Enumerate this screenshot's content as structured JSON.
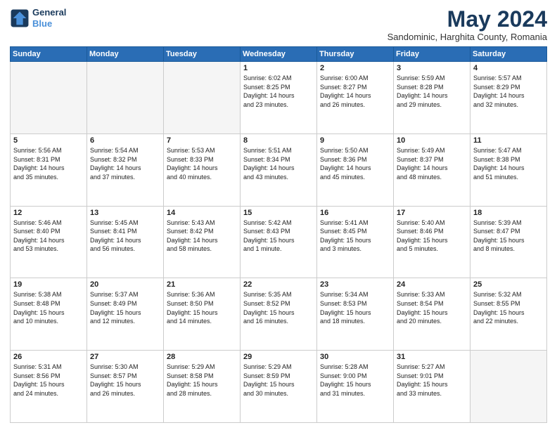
{
  "header": {
    "logo_line1": "General",
    "logo_line2": "Blue",
    "month": "May 2024",
    "location": "Sandominic, Harghita County, Romania"
  },
  "weekdays": [
    "Sunday",
    "Monday",
    "Tuesday",
    "Wednesday",
    "Thursday",
    "Friday",
    "Saturday"
  ],
  "weeks": [
    [
      {
        "day": "",
        "text": ""
      },
      {
        "day": "",
        "text": ""
      },
      {
        "day": "",
        "text": ""
      },
      {
        "day": "1",
        "text": "Sunrise: 6:02 AM\nSunset: 8:25 PM\nDaylight: 14 hours\nand 23 minutes."
      },
      {
        "day": "2",
        "text": "Sunrise: 6:00 AM\nSunset: 8:27 PM\nDaylight: 14 hours\nand 26 minutes."
      },
      {
        "day": "3",
        "text": "Sunrise: 5:59 AM\nSunset: 8:28 PM\nDaylight: 14 hours\nand 29 minutes."
      },
      {
        "day": "4",
        "text": "Sunrise: 5:57 AM\nSunset: 8:29 PM\nDaylight: 14 hours\nand 32 minutes."
      }
    ],
    [
      {
        "day": "5",
        "text": "Sunrise: 5:56 AM\nSunset: 8:31 PM\nDaylight: 14 hours\nand 35 minutes."
      },
      {
        "day": "6",
        "text": "Sunrise: 5:54 AM\nSunset: 8:32 PM\nDaylight: 14 hours\nand 37 minutes."
      },
      {
        "day": "7",
        "text": "Sunrise: 5:53 AM\nSunset: 8:33 PM\nDaylight: 14 hours\nand 40 minutes."
      },
      {
        "day": "8",
        "text": "Sunrise: 5:51 AM\nSunset: 8:34 PM\nDaylight: 14 hours\nand 43 minutes."
      },
      {
        "day": "9",
        "text": "Sunrise: 5:50 AM\nSunset: 8:36 PM\nDaylight: 14 hours\nand 45 minutes."
      },
      {
        "day": "10",
        "text": "Sunrise: 5:49 AM\nSunset: 8:37 PM\nDaylight: 14 hours\nand 48 minutes."
      },
      {
        "day": "11",
        "text": "Sunrise: 5:47 AM\nSunset: 8:38 PM\nDaylight: 14 hours\nand 51 minutes."
      }
    ],
    [
      {
        "day": "12",
        "text": "Sunrise: 5:46 AM\nSunset: 8:40 PM\nDaylight: 14 hours\nand 53 minutes."
      },
      {
        "day": "13",
        "text": "Sunrise: 5:45 AM\nSunset: 8:41 PM\nDaylight: 14 hours\nand 56 minutes."
      },
      {
        "day": "14",
        "text": "Sunrise: 5:43 AM\nSunset: 8:42 PM\nDaylight: 14 hours\nand 58 minutes."
      },
      {
        "day": "15",
        "text": "Sunrise: 5:42 AM\nSunset: 8:43 PM\nDaylight: 15 hours\nand 1 minute."
      },
      {
        "day": "16",
        "text": "Sunrise: 5:41 AM\nSunset: 8:45 PM\nDaylight: 15 hours\nand 3 minutes."
      },
      {
        "day": "17",
        "text": "Sunrise: 5:40 AM\nSunset: 8:46 PM\nDaylight: 15 hours\nand 5 minutes."
      },
      {
        "day": "18",
        "text": "Sunrise: 5:39 AM\nSunset: 8:47 PM\nDaylight: 15 hours\nand 8 minutes."
      }
    ],
    [
      {
        "day": "19",
        "text": "Sunrise: 5:38 AM\nSunset: 8:48 PM\nDaylight: 15 hours\nand 10 minutes."
      },
      {
        "day": "20",
        "text": "Sunrise: 5:37 AM\nSunset: 8:49 PM\nDaylight: 15 hours\nand 12 minutes."
      },
      {
        "day": "21",
        "text": "Sunrise: 5:36 AM\nSunset: 8:50 PM\nDaylight: 15 hours\nand 14 minutes."
      },
      {
        "day": "22",
        "text": "Sunrise: 5:35 AM\nSunset: 8:52 PM\nDaylight: 15 hours\nand 16 minutes."
      },
      {
        "day": "23",
        "text": "Sunrise: 5:34 AM\nSunset: 8:53 PM\nDaylight: 15 hours\nand 18 minutes."
      },
      {
        "day": "24",
        "text": "Sunrise: 5:33 AM\nSunset: 8:54 PM\nDaylight: 15 hours\nand 20 minutes."
      },
      {
        "day": "25",
        "text": "Sunrise: 5:32 AM\nSunset: 8:55 PM\nDaylight: 15 hours\nand 22 minutes."
      }
    ],
    [
      {
        "day": "26",
        "text": "Sunrise: 5:31 AM\nSunset: 8:56 PM\nDaylight: 15 hours\nand 24 minutes."
      },
      {
        "day": "27",
        "text": "Sunrise: 5:30 AM\nSunset: 8:57 PM\nDaylight: 15 hours\nand 26 minutes."
      },
      {
        "day": "28",
        "text": "Sunrise: 5:29 AM\nSunset: 8:58 PM\nDaylight: 15 hours\nand 28 minutes."
      },
      {
        "day": "29",
        "text": "Sunrise: 5:29 AM\nSunset: 8:59 PM\nDaylight: 15 hours\nand 30 minutes."
      },
      {
        "day": "30",
        "text": "Sunrise: 5:28 AM\nSunset: 9:00 PM\nDaylight: 15 hours\nand 31 minutes."
      },
      {
        "day": "31",
        "text": "Sunrise: 5:27 AM\nSunset: 9:01 PM\nDaylight: 15 hours\nand 33 minutes."
      },
      {
        "day": "",
        "text": ""
      }
    ]
  ]
}
